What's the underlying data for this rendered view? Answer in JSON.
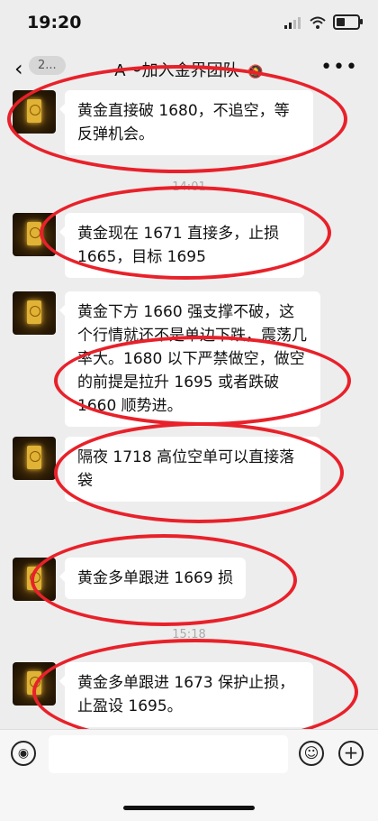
{
  "status": {
    "time": "19:20",
    "battery_level_fraction": 0.4
  },
  "nav": {
    "back_glyph": "‹",
    "unread_label": "2...",
    "title": "A～加入金界团队",
    "mute_glyph": "🔕",
    "more_glyph": "•••"
  },
  "messages": [
    {
      "text": "黄金直接破 1680，不追空，等反弹机会。"
    },
    {
      "text": "黄金现在 1671 直接多，止损 1665，目标 1695"
    },
    {
      "text": "黄金下方 1660 强支撑不破，这个行情就还不是单边下跌，震荡几率大。1680 以下严禁做空，做空的前提是拉升 1695 或者跌破 1660 顺势进。"
    },
    {
      "text": "隔夜 1718 高位空单可以直接落袋"
    },
    {
      "text": "黄金多单跟进 1669 损"
    },
    {
      "text": "黄金多单跟进 1673 保护止损，止盈设 1695。"
    }
  ],
  "timestamps": [
    "14:01",
    "15:18"
  ],
  "input_bar": {
    "voice_glyph": "◉",
    "input_placeholder": "",
    "emoji_glyph": "☺",
    "plus_glyph": "+"
  },
  "colors": {
    "bubble": "#ffffff",
    "background": "#ededed",
    "annotation_oval": "#e8212a"
  }
}
